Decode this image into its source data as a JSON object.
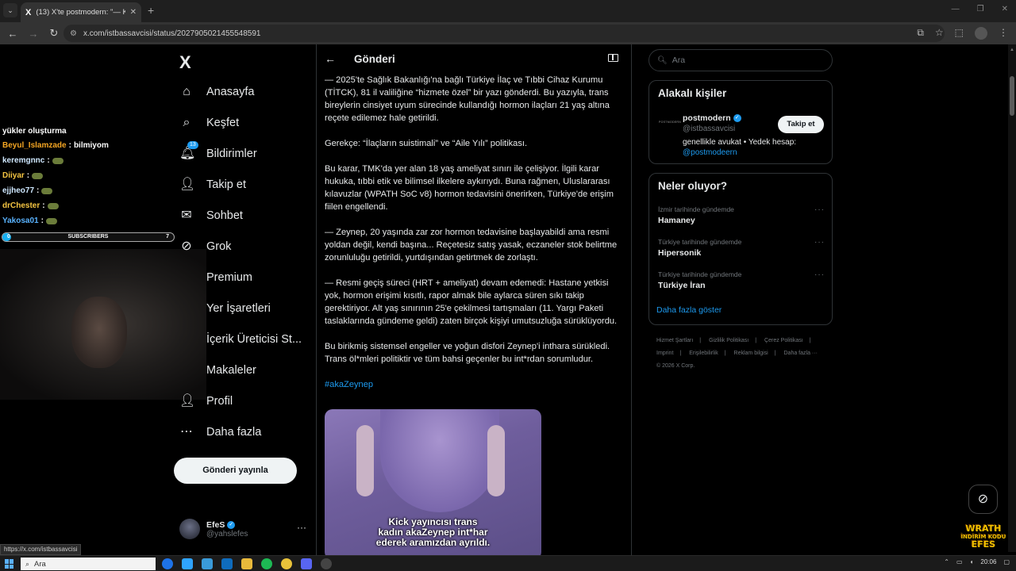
{
  "browser": {
    "tab_title": "(13) X'te postmodern: \"— Kick yayın",
    "tab_logo": "X",
    "new_tab": "+",
    "url": "x.com/istbassavcisi/status/2027905021455548591",
    "status_url": "https://x.com/istbassavcisi"
  },
  "overlay": {
    "chat_header": "yükler oluşturma",
    "chat": [
      {
        "user": "Beyul_Islamzade",
        "msg": "bilmiyom",
        "color": "#f5a623"
      },
      {
        "user": "keremgnnc",
        "msg": "",
        "color": "#cfe8ff"
      },
      {
        "user": "Diiyar",
        "msg": "",
        "color": "#f5c542"
      },
      {
        "user": "ejjheo77",
        "msg": "",
        "color": "#cfe8ff"
      },
      {
        "user": "drChester",
        "msg": "",
        "color": "#f5c542"
      },
      {
        "user": "Yakosa01",
        "msg": "",
        "color": "#5ab3ff"
      }
    ],
    "subscribers": {
      "label": "SUBSCRIBERS",
      "current": "0",
      "goal": "7",
      "progress": 0.05
    }
  },
  "nav": {
    "logo": "X",
    "items": [
      {
        "label": "Anasayfa",
        "icon": "home-icon"
      },
      {
        "label": "Keşfet",
        "icon": "search-icon"
      },
      {
        "label": "Bildirimler",
        "icon": "bell-icon",
        "badge": "13"
      },
      {
        "label": "Takip et",
        "icon": "add-user-icon"
      },
      {
        "label": "Sohbet",
        "icon": "mail-icon"
      },
      {
        "label": "Grok",
        "icon": "grok-icon"
      },
      {
        "label": "Premium",
        "icon": "x-premium-icon"
      },
      {
        "label": "Yer İşaretleri",
        "icon": "bookmark-icon"
      },
      {
        "label": "İçerik Üreticisi St...",
        "icon": "creator-studio-icon"
      },
      {
        "label": "Makaleler",
        "icon": "article-icon"
      },
      {
        "label": "Profil",
        "icon": "profile-icon"
      },
      {
        "label": "Daha fazla",
        "icon": "more-circle-icon"
      }
    ],
    "post_button": "Gönderi yayınla",
    "account": {
      "name": "EfeS",
      "handle": "@yahslefes",
      "more": "···"
    }
  },
  "main": {
    "title": "Gönderi",
    "paragraphs": [
      "— 2025'te Sağlık Bakanlığı'na bağlı Türkiye İlaç ve Tıbbi Cihaz Kurumu (TİTCK), 81 il valiliğine “hizmete özel” bir yazı gönderdi. Bu yazıyla, trans bireylerin cinsiyet uyum sürecinde kullandığı hormon ilaçları 21 yaş altına reçete edilemez hale getirildi.",
      "Gerekçe: “İlaçların suistimali” ve “Aile Yılı” politikası.",
      "Bu karar, TMK'da yer alan 18 yaş ameliyat sınırı ile çelişiyor. İlgili karar hukuka, tıbbi etik ve bilimsel ilkelere aykırıydı. Buna rağmen, Uluslararası kılavuzlar (WPATH SoC v8) hormon tedavisini önerirken, Türkiye'de erişim fiilen engellendi.",
      "— Zeynep, 20 yaşında zar zor hormon tedavisine başlayabildi ama resmi yoldan değil, kendi başına... Reçetesiz satış yasak, eczaneler stok belirtme zorunluluğu getirildi, yurtdışından getirtmek de zorlaştı.",
      "— Resmi geçiş süreci (HRT + ameliyat) devam edemedi: Hastane yetkisi yok, hormon erişimi kısıtlı, rapor almak bile aylarca süren sıkı takip gerektiriyor. Alt yaş sınırının 25'e çekilmesi tartışmaları (11. Yargı Paketi taslaklarında gündeme geldi) zaten birçok kişiyi umutsuzluğa sürüklüyordu.",
      "Bu birikmiş sistemsel engeller ve yoğun disfori Zeynep'i inthara sürükledi. Trans öl*mleri politiktir ve tüm bahsi geçenler bu int*rdan sorumludur."
    ],
    "hashtag": "#akaZeynep",
    "media_caption_1": "Kick yayıncısı trans",
    "media_caption_2": "kadın akaZeynep int*har",
    "media_caption_3": "ederek aramızdan ayrıldı."
  },
  "right": {
    "search_placeholder": "Ara",
    "people_title": "Alakalı kişiler",
    "person": {
      "logo_text": "POSTMODERN",
      "name": "postmodern",
      "handle": "@istbassavcisi",
      "bio": "genellikle avukat • Yedek hesap:",
      "bio_link": "@postmodeern",
      "follow": "Takip et"
    },
    "trends_title": "Neler oluyor?",
    "trends": [
      {
        "meta": "İzmir tarihinde gündemde",
        "name": "Hamaney"
      },
      {
        "meta": "Türkiye tarihinde gündemde",
        "name": "Hipersonik"
      },
      {
        "meta": "Türkiye tarihinde gündemde",
        "name": "Türkiye İran"
      }
    ],
    "show_more": "Daha fazla göster",
    "footer": [
      "Hizmet Şartları",
      "|",
      "Gizlilik Politikası",
      "|",
      "Çerez Politikası",
      "|",
      "Imprint",
      "|",
      "Erişilebilirlik",
      "|",
      "Reklam bilgisi",
      "|",
      "Daha fazla ···",
      "© 2026 X Corp."
    ]
  },
  "promo": {
    "line1": "WRATH",
    "line2": "İNDİRİM KODU",
    "line3": "EFES"
  },
  "taskbar": {
    "search": "Ara",
    "time": "20:06"
  },
  "colors": {
    "accent": "#1d9bf0",
    "background": "#000000",
    "border": "#2f3336",
    "muted": "#71767b"
  }
}
